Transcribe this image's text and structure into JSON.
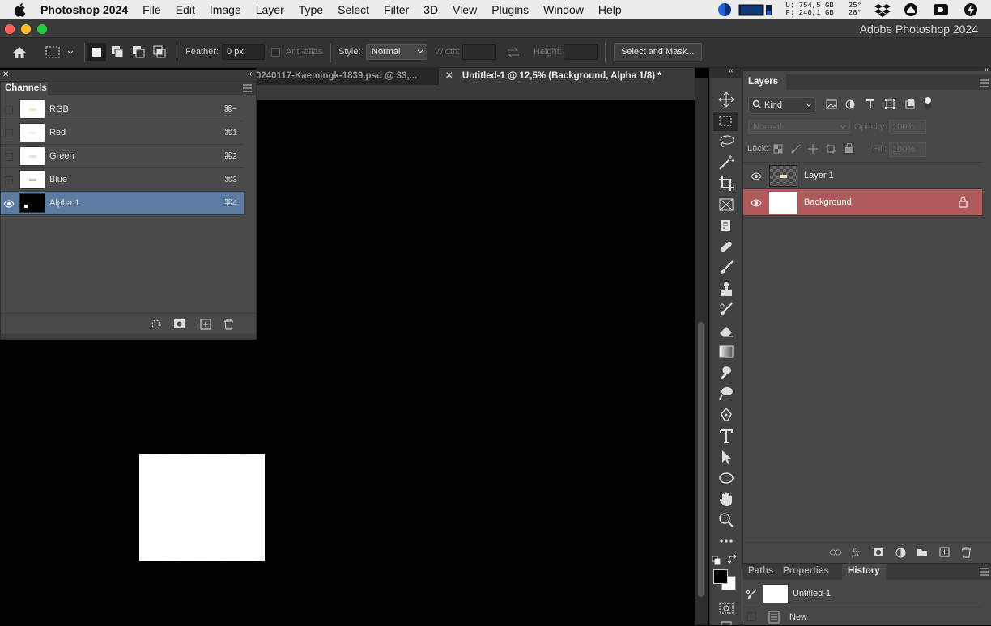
{
  "menubar": {
    "app_name": "Photoshop 2024",
    "items": [
      "File",
      "Edit",
      "Image",
      "Layer",
      "Type",
      "Select",
      "Filter",
      "3D",
      "View",
      "Plugins",
      "Window",
      "Help"
    ],
    "disk_used": "U:  754,5 GB",
    "disk_free": "F:  240,1 GB",
    "temp1": "25°",
    "temp2": "28°"
  },
  "window": {
    "title": "Adobe Photoshop 2024"
  },
  "options": {
    "feather_label": "Feather:",
    "feather_value": "0 px",
    "antialias_label": "Anti-alias",
    "style_label": "Style:",
    "style_value": "Normal",
    "width_label": "Width:",
    "height_label": "Height:",
    "select_mask": "Select and Mask..."
  },
  "tabs": [
    {
      "label": "0240117-Kaemingk-1839.psd @ 33,..."
    },
    {
      "label": "Untitled-1 @ 12,5% (Background, Alpha 1/8) *"
    }
  ],
  "channels": {
    "title": "Channels",
    "rows": [
      {
        "name": "RGB",
        "key": "⌘~"
      },
      {
        "name": "Red",
        "key": "⌘1"
      },
      {
        "name": "Green",
        "key": "⌘2"
      },
      {
        "name": "Blue",
        "key": "⌘3"
      },
      {
        "name": "Alpha 1",
        "key": "⌘4"
      }
    ]
  },
  "layers": {
    "title": "Layers",
    "kind": "Kind",
    "blend_mode": "Normal",
    "opacity_label": "Opacity:",
    "opacity_value": "100%",
    "lock_label": "Lock:",
    "fill_label": "Fill:",
    "fill_value": "100%",
    "rows": [
      {
        "name": "Layer 1"
      },
      {
        "name": "Background"
      }
    ]
  },
  "bottom_panel": {
    "tabs": [
      "Paths",
      "Properties",
      "History"
    ],
    "history_snapshot": "Untitled-1",
    "history_item": "New"
  },
  "colors": {
    "selected_channel": "#5c7ca1",
    "selected_layer": "#b05b5b",
    "panel_bg": "#474747"
  }
}
